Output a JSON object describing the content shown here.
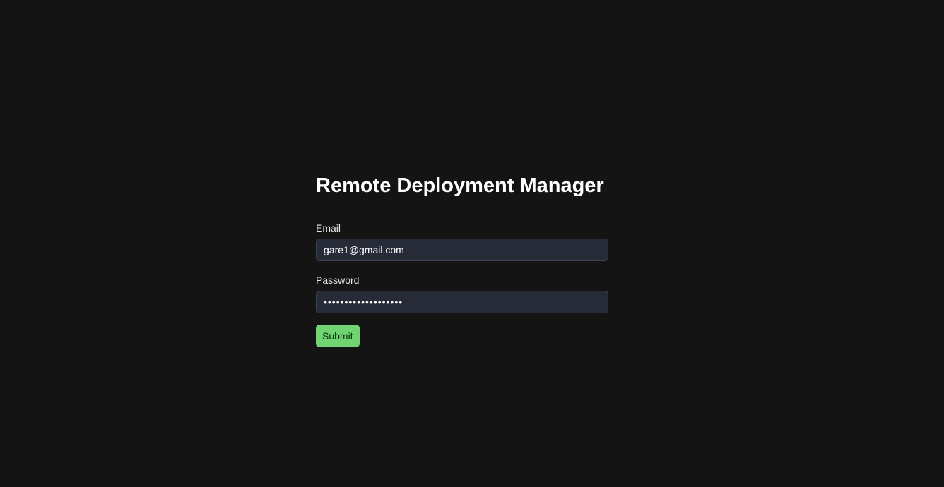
{
  "page": {
    "title": "Remote Deployment Manager"
  },
  "form": {
    "email_label": "Email",
    "email_value": "gare1@gmail.com",
    "password_label": "Password",
    "password_value": "supersecretpassword",
    "submit_label": "Submit"
  },
  "colors": {
    "background": "#141414",
    "input_background": "#262b37",
    "submit_button": "#6fd471"
  }
}
